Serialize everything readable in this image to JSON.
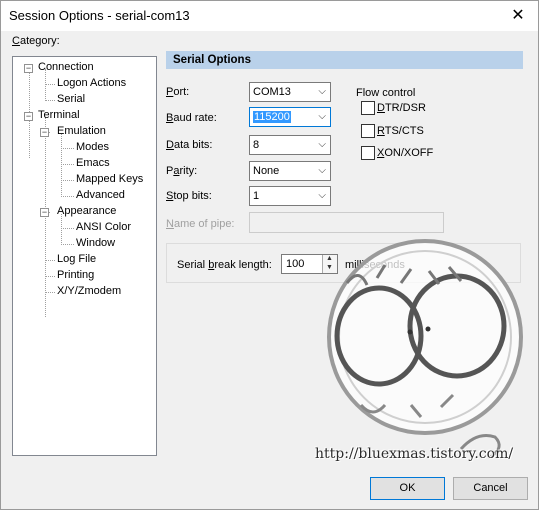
{
  "window": {
    "title": "Session Options - serial-com13",
    "close_glyph": "✕"
  },
  "category": {
    "label": "Category:",
    "tree": [
      {
        "label": "Connection",
        "expander": "−"
      },
      {
        "label": "Logon Actions"
      },
      {
        "label": "Serial"
      },
      {
        "label": "Terminal",
        "expander": "−"
      },
      {
        "label": "Emulation",
        "expander": "−"
      },
      {
        "label": "Modes"
      },
      {
        "label": "Emacs"
      },
      {
        "label": "Mapped Keys"
      },
      {
        "label": "Advanced"
      },
      {
        "label": "Appearance",
        "expander": "−"
      },
      {
        "label": "ANSI Color"
      },
      {
        "label": "Window"
      },
      {
        "label": "Log File"
      },
      {
        "label": "Printing"
      },
      {
        "label": "X/Y/Zmodem"
      }
    ]
  },
  "serial": {
    "section_title": "Serial Options",
    "port": {
      "label_key": "P",
      "label_rest": "ort:",
      "value": "COM13"
    },
    "baud": {
      "label_key": "B",
      "label_rest": "aud rate:",
      "value": "115200"
    },
    "data_bits": {
      "label_key": "D",
      "label_rest": "ata bits:",
      "value": "8"
    },
    "parity": {
      "label_pre": "P",
      "label_key": "a",
      "label_rest": "rity:",
      "value": "None"
    },
    "stop_bits": {
      "label_key": "S",
      "label_rest": "top bits:",
      "value": "1"
    },
    "pipe": {
      "label_key": "N",
      "label_rest": "ame of pipe:",
      "value": ""
    },
    "arrow_glyph": "⌵"
  },
  "flow_control": {
    "title": "Flow control",
    "options": [
      {
        "label_key": "D",
        "label_rest": "TR/DSR",
        "checked": false
      },
      {
        "label_key": "R",
        "label_rest": "TS/CTS",
        "checked": false
      },
      {
        "label_key": "X",
        "label_rest": "ON/XOFF",
        "checked": false
      }
    ]
  },
  "serial_break": {
    "label_pre": "Serial ",
    "label_key": "b",
    "label_rest": "reak length:",
    "value": "100",
    "unit": "milliseconds"
  },
  "buttons": {
    "ok": "OK",
    "cancel": "Cancel"
  },
  "watermark": {
    "text": "http://bluexmas.tistory.com/"
  }
}
